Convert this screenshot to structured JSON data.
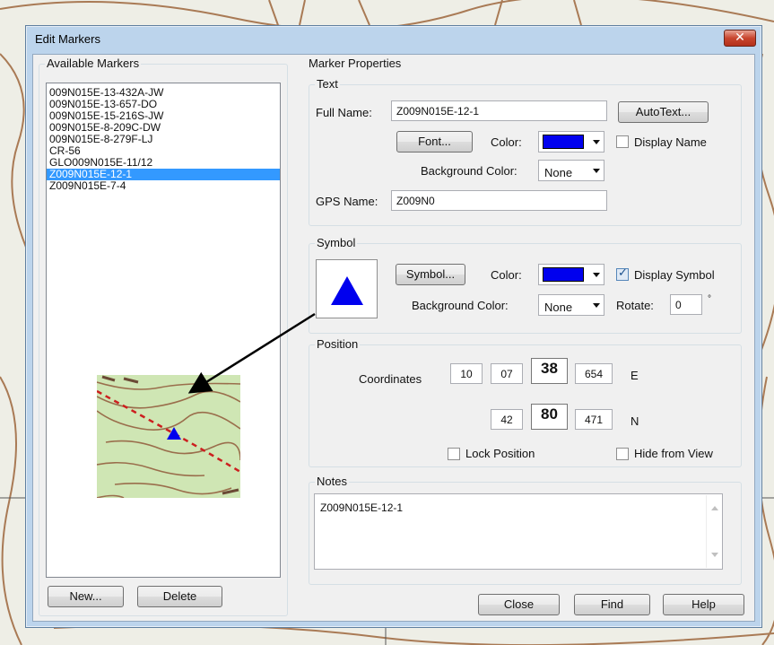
{
  "window": {
    "title": "Edit Markers",
    "close_glyph": "✕"
  },
  "available": {
    "legend": "Available Markers",
    "items": [
      "009N015E-13-432A-JW",
      "009N015E-13-657-DO",
      "009N015E-15-216S-JW",
      "009N015E-8-209C-DW",
      "009N015E-8-279F-LJ",
      "CR-56",
      "GLO009N015E-11/12",
      "Z009N015E-12-1",
      "Z009N015E-7-4"
    ],
    "selected_index": 7,
    "new_label": "New...",
    "delete_label": "Delete"
  },
  "props": {
    "legend": "Marker Properties"
  },
  "text": {
    "legend": "Text",
    "full_name_label": "Full Name:",
    "full_name": "Z009N015E-12-1",
    "autotext_label": "AutoText...",
    "font_label": "Font...",
    "color_label": "Color:",
    "display_name_label": "Display Name",
    "bg_color_label": "Background Color:",
    "bg_color": "None",
    "gps_label": "GPS Name:",
    "gps_name": "Z009N0"
  },
  "symbol": {
    "legend": "Symbol",
    "symbol_label": "Symbol...",
    "color_label": "Color:",
    "display_symbol_label": "Display Symbol",
    "bg_color_label": "Background Color:",
    "bg_color": "None",
    "rotate_label": "Rotate:",
    "rotate_value": "0",
    "degree": "°",
    "color": "#0000ee"
  },
  "position": {
    "legend": "Position",
    "coordinates_label": "Coordinates",
    "easting": [
      "10",
      "07",
      "38",
      "654"
    ],
    "easting_suffix": "E",
    "northing": [
      "42",
      "80",
      "471"
    ],
    "northing_suffix": "N",
    "lock_label": "Lock Position",
    "hide_label": "Hide from View"
  },
  "notes": {
    "legend": "Notes",
    "text": "Z009N015E-12-1"
  },
  "buttons": {
    "close": "Close",
    "find": "Find",
    "help": "Help"
  }
}
